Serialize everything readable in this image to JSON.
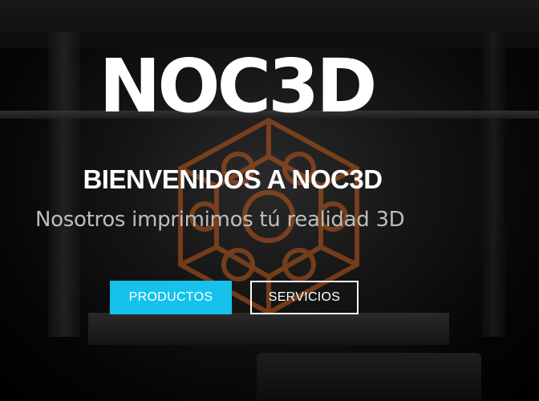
{
  "hero": {
    "logo": "NOC3D",
    "headline": "BIENVENIDOS A NOC3D",
    "tagline": "Nosotros imprimimos tú realidad 3D",
    "buttons": {
      "primary_label": "PRODUCTOS",
      "secondary_label": "SERVICIOS"
    }
  },
  "colors": {
    "accent": "#14c2ec",
    "print_object": "#c05a1c",
    "background": "#000000"
  }
}
